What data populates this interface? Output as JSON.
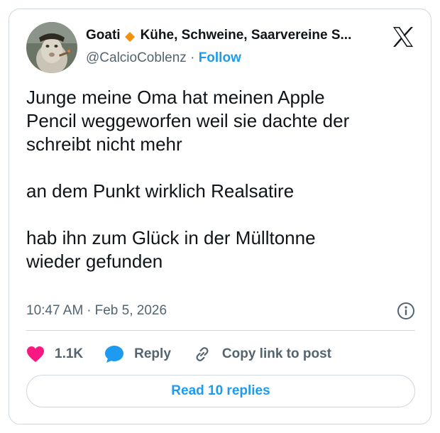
{
  "author": {
    "display_name_first": "Goati",
    "display_name_rest": "Kühe, Schweine, Saarvereine S...",
    "handle": "@CalcioCoblenz",
    "separator": "·",
    "follow_label": "Follow"
  },
  "tweet": {
    "text": "Junge meine Oma hat meinen Apple\nPencil weggeworfen weil sie dachte der\nschreibt nicht mehr\n\nan dem Punkt wirklich Realsatire\n\nhab ihn zum Glück in der Mülltonne\nwieder gefunden",
    "time": "10:47 AM",
    "separator": "·",
    "date": "Feb 5, 2026"
  },
  "actions": {
    "like_count": "1.1K",
    "reply_label": "Reply",
    "copy_link_label": "Copy link to post"
  },
  "read_replies_label": "Read 10 replies",
  "icons": {
    "platform_logo": "x-logo-icon",
    "diamond": "orange-diamond-icon",
    "info": "info-icon",
    "heart": "heart-icon",
    "reply": "speech-bubble-icon",
    "link": "link-icon"
  },
  "colors": {
    "accent": "#1d9bf0",
    "like": "#f91880",
    "reply_bubble": "#1d9bf0",
    "diamond": "#f4900c",
    "text_primary": "#0f1419",
    "text_secondary": "#536471",
    "border": "#cfd9de"
  }
}
